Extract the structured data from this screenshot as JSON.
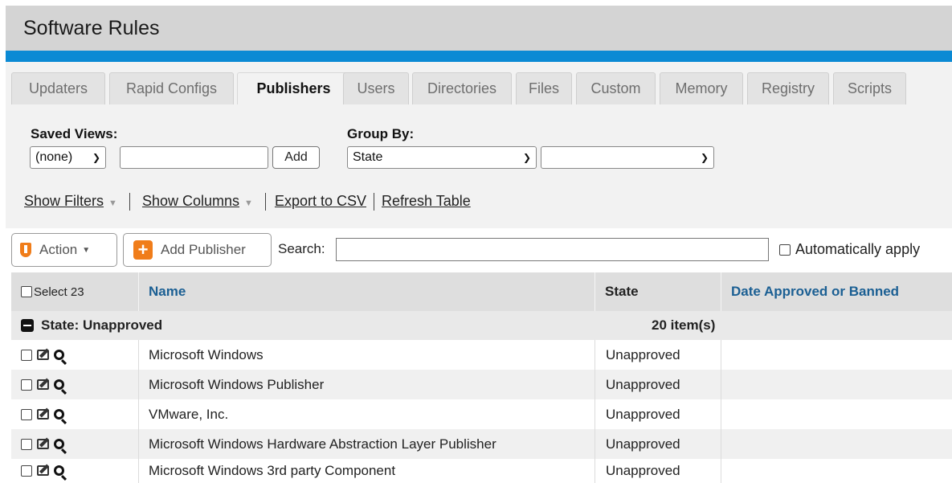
{
  "header": {
    "title": "Software Rules"
  },
  "tabs": [
    {
      "label": "Updaters"
    },
    {
      "label": "Rapid Configs"
    },
    {
      "label": "Publishers"
    },
    {
      "label": "Users"
    },
    {
      "label": "Directories"
    },
    {
      "label": "Files"
    },
    {
      "label": "Custom"
    },
    {
      "label": "Memory"
    },
    {
      "label": "Registry"
    },
    {
      "label": "Scripts"
    }
  ],
  "active_tab": "Publishers",
  "saved_views": {
    "label": "Saved Views:",
    "selected": "(none)",
    "name_value": "",
    "add_label": "Add"
  },
  "group_by": {
    "label": "Group By:",
    "selected": "State",
    "secondary_selected": ""
  },
  "links": {
    "show_filters": "Show Filters",
    "show_columns": "Show Columns",
    "export_csv": "Export to CSV",
    "refresh": "Refresh Table"
  },
  "toolbar": {
    "action_label": "Action",
    "add_publisher_label": "Add Publisher",
    "search_label": "Search:",
    "search_value": "",
    "auto_apply_label": "Automatically apply"
  },
  "table": {
    "select_label": "Select 23",
    "columns": [
      "Name",
      "State",
      "Date Approved or Banned"
    ],
    "group": {
      "label": "State: Unapproved",
      "count": "20 item(s)"
    },
    "rows": [
      {
        "name": "Microsoft Windows",
        "state": "Unapproved",
        "date": ""
      },
      {
        "name": "Microsoft Windows Publisher",
        "state": "Unapproved",
        "date": ""
      },
      {
        "name": "VMware, Inc.",
        "state": "Unapproved",
        "date": ""
      },
      {
        "name": "Microsoft Windows Hardware Abstraction Layer Publisher",
        "state": "Unapproved",
        "date": ""
      },
      {
        "name": "Microsoft Windows 3rd party Component",
        "state": "Unapproved",
        "date": ""
      }
    ]
  },
  "colors": {
    "accent_blue": "#0b8ad4",
    "header_gray": "#d4d4d4",
    "orange": "#f07d1a",
    "link_blue": "#1b5f93"
  }
}
